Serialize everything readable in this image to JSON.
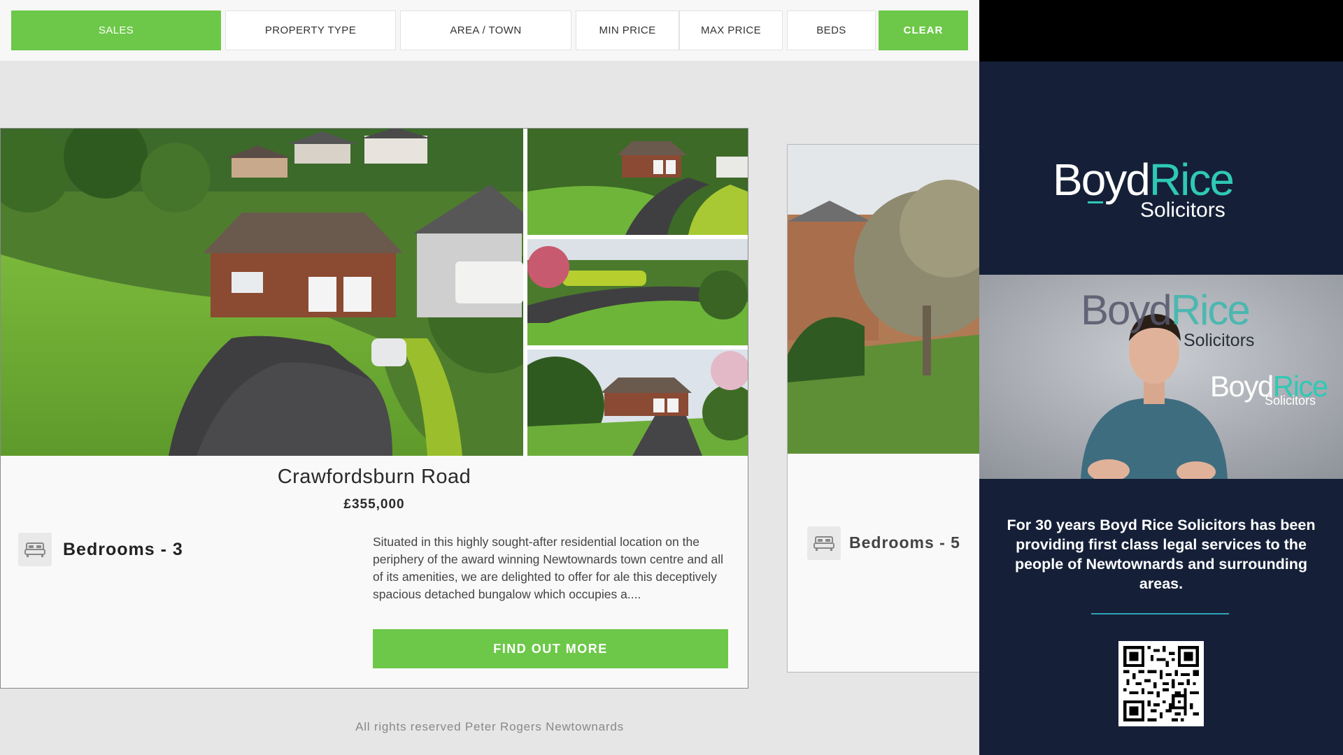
{
  "filters": {
    "sales": "SALES",
    "property_type": "PROPERTY TYPE",
    "area_town": "AREA / TOWN",
    "min_price": "MIN PRICE",
    "max_price": "MAX PRICE",
    "beds": "BEDS",
    "clear": "CLEAR"
  },
  "listing": {
    "title": "Crawfordsburn Road",
    "price": "£355,000",
    "bedrooms": "Bedrooms - 3",
    "description": "Situated in this highly sought-after residential location on the periphery of the award winning Newtownards town centre and all of its amenities, we are delighted to offer for ale this deceptively spacious detached bungalow which occupies a....",
    "cta": "FIND OUT MORE"
  },
  "listing2": {
    "bedrooms": "Bedrooms - 5"
  },
  "footer": "All rights reserved Peter Rogers Newtownards",
  "ad": {
    "brand_part1": "Boyd",
    "brand_part2": "Rice",
    "brand_sub": "Solicitors",
    "text": "For 30 years Boyd Rice Solicitors has been providing first class legal services to the people of Newtownards and surrounding areas."
  },
  "colors": {
    "accent_green": "#6dc849",
    "navy": "#152038",
    "teal": "#2fc9b5"
  }
}
